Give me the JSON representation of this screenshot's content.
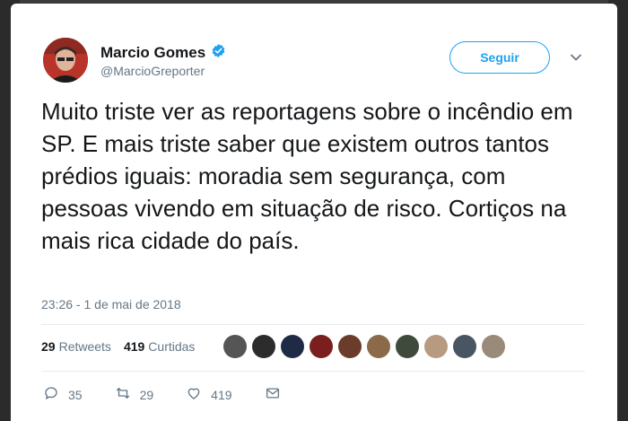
{
  "header": {
    "name": "Marcio Gomes",
    "handle": "@MarcioGreporter",
    "follow_label": "Seguir",
    "verified_icon": "verified-badge-icon",
    "caret_icon": "chevron-down-icon"
  },
  "tweet": {
    "text": "Muito triste ver as reportagens sobre o incêndio em SP. E mais triste saber que existem outros tantos prédios iguais: moradia sem segurança, com pessoas vivendo em situação de risco. Cortiços na mais rica cidade do país.",
    "timestamp": "23:26 - 1 de mai de 2018"
  },
  "stats": {
    "retweets_count": "29",
    "retweets_label": "Retweets",
    "likes_count": "419",
    "likes_label": "Curtidas"
  },
  "actions": {
    "reply_count": "35",
    "retweet_count": "29",
    "like_count": "419"
  },
  "colors": {
    "accent": "#1da1f2",
    "text": "#14171a",
    "muted": "#657786"
  }
}
